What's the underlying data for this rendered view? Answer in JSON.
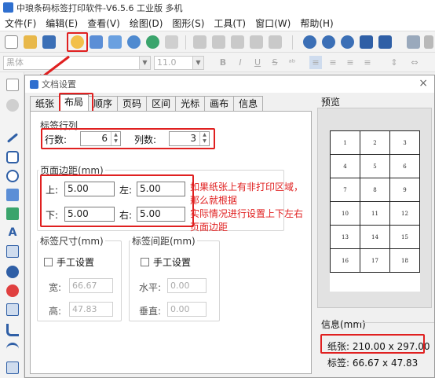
{
  "app": {
    "title": "中琅条码标签打印软件-V6.5.6 工业版 多机"
  },
  "menu": [
    "文件(F)",
    "编辑(E)",
    "查看(V)",
    "绘图(D)",
    "图形(S)",
    "工具(T)",
    "窗口(W)",
    "帮助(H)"
  ],
  "toolbar2": {
    "font_name": "黑体",
    "font_size": "11.0"
  },
  "dialog": {
    "title": "文档设置",
    "close": "×",
    "tabs": [
      "纸张",
      "布局",
      "顺序",
      "页码",
      "区间",
      "光标",
      "画布",
      "信息"
    ],
    "active_tab": "布局",
    "rows_cols": {
      "title": "标签行列",
      "rows_label": "行数:",
      "rows_value": "6",
      "cols_label": "列数:",
      "cols_value": "3"
    },
    "margins": {
      "title": "页面边距(mm)",
      "top_label": "上:",
      "top_value": "5.00",
      "left_label": "左:",
      "left_value": "5.00",
      "bottom_label": "下:",
      "bottom_value": "5.00",
      "right_label": "右:",
      "right_value": "5.00"
    },
    "annotation": {
      "line1": "如果纸张上有非打印区域，那么就根据",
      "line2": "实际情况进行设置上下左右页面边距"
    },
    "label_size": {
      "title": "标签尺寸(mm)",
      "manual": "手工设置",
      "width_label": "宽:",
      "width_value": "66.67",
      "height_label": "高:",
      "height_value": "47.83"
    },
    "label_gap": {
      "title": "标签间距(mm)",
      "manual": "手工设置",
      "h_label": "水平:",
      "h_value": "0.00",
      "v_label": "垂直:",
      "v_value": "0.00"
    },
    "preview": {
      "title": "预览",
      "cells": [
        [
          "1",
          "2",
          "3"
        ],
        [
          "4",
          "5",
          "6"
        ],
        [
          "7",
          "8",
          "9"
        ],
        [
          "10",
          "11",
          "12"
        ],
        [
          "13",
          "14",
          "15"
        ],
        [
          "16",
          "17",
          "18"
        ]
      ]
    },
    "info": {
      "title": "信息(mm)",
      "paper": "纸张: 210.00 x 297.00",
      "label": "标签: 66.67 x 47.83"
    }
  },
  "colors": {
    "highlight": "#e02020",
    "accent": "#2f6fcf"
  }
}
